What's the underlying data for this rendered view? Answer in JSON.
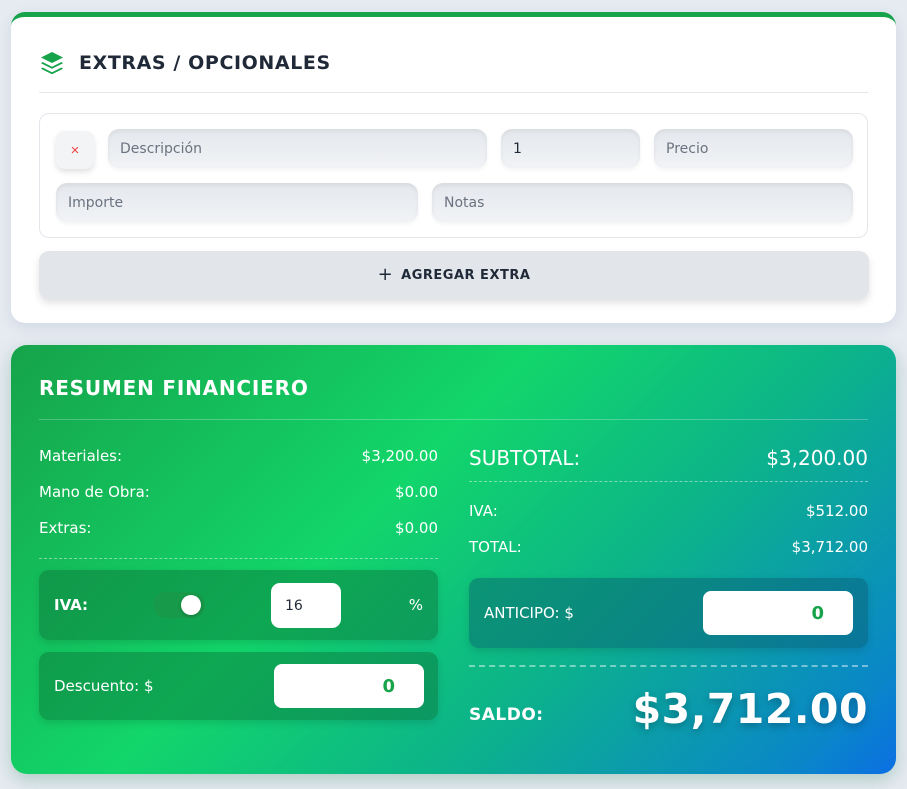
{
  "extras": {
    "title": "EXTRAS / OPCIONALES",
    "icon": "layers-icon",
    "accent_color": "#16a34a",
    "row": {
      "remove_label": "×",
      "description_placeholder": "Descripción",
      "quantity_value": "1",
      "price_placeholder": "Precio",
      "amount_placeholder": "Importe",
      "notes_placeholder": "Notas"
    },
    "add_button": {
      "icon": "+",
      "label": "AGREGAR EXTRA"
    }
  },
  "summary": {
    "title": "RESUMEN FINANCIERO",
    "materials": {
      "label": "Materiales:",
      "value": "$3,200.00"
    },
    "labor": {
      "label": "Mano de Obra:",
      "value": "$0.00"
    },
    "extras": {
      "label": "Extras:",
      "value": "$0.00"
    },
    "iva_control": {
      "label": "IVA:",
      "enabled": true,
      "rate": "16",
      "suffix": "%"
    },
    "discount": {
      "label": "Descuento: $",
      "value": "0"
    },
    "subtotal": {
      "label": "SUBTOTAL:",
      "value": "$3,200.00"
    },
    "iva": {
      "label": "IVA:",
      "value": "$512.00"
    },
    "total": {
      "label": "TOTAL:",
      "value": "$3,712.00"
    },
    "advance": {
      "label": "ANTICIPO: $",
      "value": "0"
    },
    "balance": {
      "label": "SALDO:",
      "value": "$3,712.00"
    },
    "colors": {
      "gradient_start": "#16a34a",
      "gradient_end": "#0b6fe3",
      "input_value": "#16a34a"
    }
  }
}
